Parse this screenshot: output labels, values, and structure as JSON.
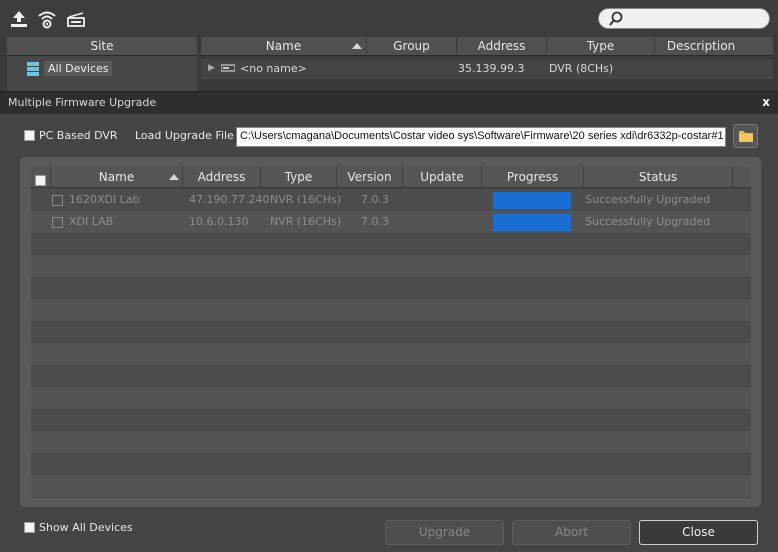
{
  "toolbar": {
    "icons": [
      "upload-icon",
      "wireless-icon",
      "device-icon"
    ],
    "search": {
      "placeholder": "",
      "value": ""
    }
  },
  "site_panel": {
    "header": "Site",
    "items": [
      {
        "label": "All Devices",
        "icon": "device-list-icon"
      }
    ]
  },
  "device_list": {
    "columns": [
      "Name",
      "Group",
      "Address",
      "Type",
      "Description"
    ],
    "rows": [
      {
        "name": "<no name>",
        "group": "",
        "address": "35.139.99.3",
        "type": "DVR (8CHs)",
        "description": ""
      }
    ]
  },
  "dialog": {
    "title": "Multiple Firmware Upgrade",
    "close": "x",
    "pc_based_dvr_label": "PC Based DVR",
    "pc_based_dvr_checked": false,
    "load_file_label": "Load Upgrade File :",
    "file_path": "C:\\Users\\cmagana\\Documents\\Costar video sys\\Software\\Firmware\\20 series xdi\\dr6332p-costar#1",
    "table": {
      "columns": [
        "Name",
        "Address",
        "Type",
        "Version",
        "Update",
        "Progress",
        "Status"
      ],
      "rows": [
        {
          "name": "1620XDI Lab",
          "address": "47.190.77.240",
          "type": "NVR (16CHs)",
          "version": "7.0.3",
          "update": "",
          "progress": 1.0,
          "status": "Successfully Upgraded"
        },
        {
          "name": "XDI LAB",
          "address": "10.6.0.130",
          "type": "NVR (16CHs)",
          "version": "7.0.3",
          "update": "",
          "progress": 1.0,
          "status": "Successfully Upgraded"
        }
      ]
    },
    "show_all_devices_label": "Show All Devices",
    "show_all_devices_checked": false,
    "buttons": {
      "upgrade": "Upgrade",
      "abort": "Abort",
      "close": "Close"
    }
  },
  "colors": {
    "progress_fill": "#1a6fd4",
    "dialog_bg": "#444444"
  }
}
